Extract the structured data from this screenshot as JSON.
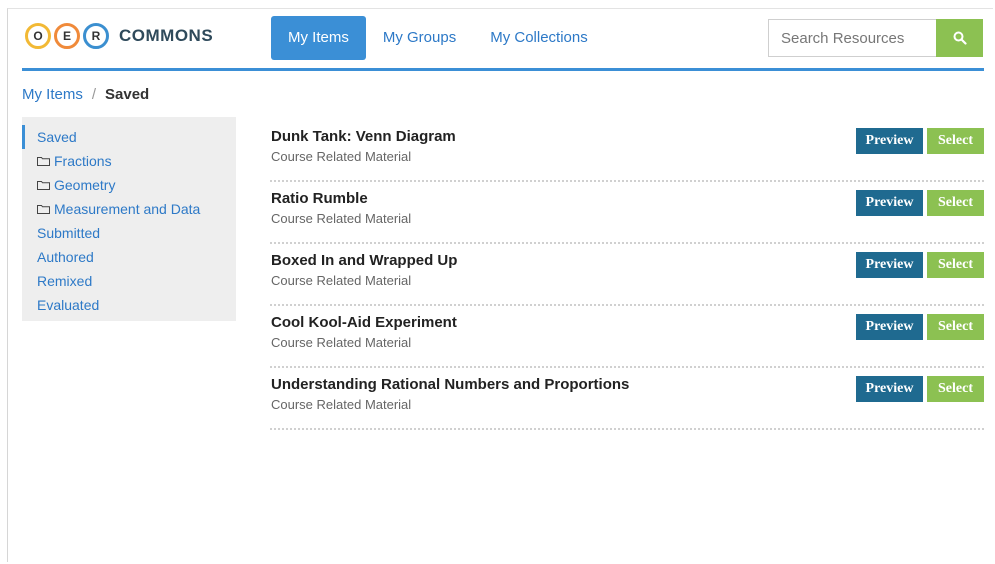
{
  "header": {
    "logo_letters": [
      "O",
      "E",
      "R"
    ],
    "logo_text": "COMMONS",
    "tabs": [
      {
        "label": "My Items"
      },
      {
        "label": "My Groups"
      },
      {
        "label": "My Collections"
      }
    ],
    "active_tab": "My Items",
    "search": {
      "placeholder": "Search Resources",
      "value": ""
    },
    "colors": {
      "accent": "#3b8fd6",
      "green": "#8cc152",
      "preview": "#1f6a90"
    }
  },
  "breadcrumb": {
    "parent": "My Items",
    "separator": "/",
    "current": "Saved"
  },
  "sidebar": {
    "items": [
      {
        "label": "Saved",
        "icon": ""
      },
      {
        "label": "Fractions",
        "icon": "folder-icon"
      },
      {
        "label": "Geometry",
        "icon": "folder-icon"
      },
      {
        "label": "Measurement and Data",
        "icon": "folder-icon"
      },
      {
        "label": "Submitted",
        "icon": ""
      },
      {
        "label": "Authored",
        "icon": ""
      },
      {
        "label": "Remixed",
        "icon": ""
      },
      {
        "label": "Evaluated",
        "icon": ""
      }
    ]
  },
  "items": [
    {
      "title": "Dunk Tank: Venn Diagram",
      "type": "Course Related Material"
    },
    {
      "title": "Ratio Rumble",
      "type": "Course Related Material"
    },
    {
      "title": "Boxed In and Wrapped Up",
      "type": "Course Related Material"
    },
    {
      "title": "Cool Kool-Aid Experiment",
      "type": "Course Related Material"
    },
    {
      "title": "Understanding Rational Numbers and Proportions",
      "type": "Course Related Material"
    }
  ],
  "buttons": {
    "preview": "Preview",
    "select": "Select"
  }
}
